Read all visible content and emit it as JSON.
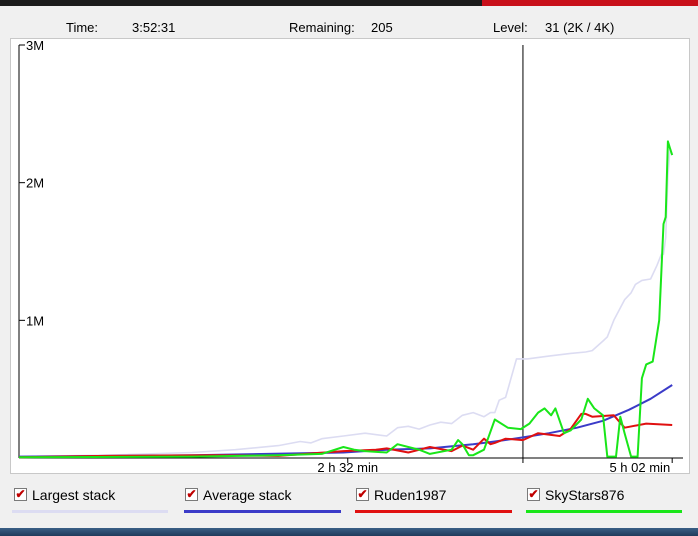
{
  "status": {
    "time_label": "Time:",
    "time_value": "3:52:31",
    "remaining_label": "Remaining:",
    "remaining_value": "205",
    "level_label": "Level:",
    "level_value": "31 (2K / 4K)"
  },
  "legend": [
    {
      "label": "Largest stack",
      "color": "#dcdcf2",
      "checked": true
    },
    {
      "label": "Average stack",
      "color": "#3b3bc8",
      "checked": true
    },
    {
      "label": "Ruden1987",
      "color": "#e01010",
      "checked": true
    },
    {
      "label": "SkyStars876",
      "color": "#19e619",
      "checked": true
    }
  ],
  "chart_data": {
    "type": "line",
    "title": "",
    "xlabel": "",
    "ylabel": "",
    "x_unit": "minutes",
    "xlim": [
      0,
      307
    ],
    "ylim": [
      0,
      3000000
    ],
    "y_ticks": [
      {
        "value": 1000000,
        "label": "1M"
      },
      {
        "value": 2000000,
        "label": "2M"
      },
      {
        "value": 3000000,
        "label": "3M"
      }
    ],
    "x_ticks": [
      {
        "value": 152,
        "label": "2 h 32 min"
      },
      {
        "value": 302,
        "label": "5 h 02 min"
      }
    ],
    "vertical_marker_x": 233,
    "grid": false,
    "series": [
      {
        "name": "Largest stack",
        "color": "#dcdcf2",
        "x": [
          0,
          40,
          80,
          100,
          120,
          130,
          135,
          140,
          150,
          160,
          170,
          175,
          180,
          185,
          190,
          195,
          200,
          205,
          210,
          215,
          218,
          220,
          222,
          225,
          230,
          235,
          245,
          255,
          262,
          265,
          270,
          272,
          275,
          280,
          283,
          285,
          288,
          292,
          295,
          297,
          298,
          299,
          300,
          301,
          302
        ],
        "y": [
          10000,
          20000,
          40000,
          60000,
          90000,
          120000,
          110000,
          140000,
          160000,
          180000,
          160000,
          220000,
          230000,
          210000,
          240000,
          260000,
          250000,
          310000,
          330000,
          300000,
          330000,
          330000,
          420000,
          440000,
          720000,
          720000,
          740000,
          760000,
          770000,
          780000,
          850000,
          880000,
          1000000,
          1150000,
          1200000,
          1260000,
          1290000,
          1300000,
          1400000,
          1480000,
          1480000,
          1600000,
          2050000,
          2250000,
          2200000
        ]
      },
      {
        "name": "Average stack",
        "color": "#3b3bc8",
        "x": [
          0,
          80,
          150,
          170,
          190,
          210,
          220,
          233,
          245,
          258,
          270,
          282,
          292,
          302
        ],
        "y": [
          10000,
          20000,
          40000,
          60000,
          70000,
          100000,
          120000,
          150000,
          180000,
          220000,
          270000,
          350000,
          430000,
          530000
        ]
      },
      {
        "name": "Ruden1987",
        "color": "#e01010",
        "x": [
          0,
          40,
          90,
          120,
          150,
          165,
          170,
          180,
          190,
          200,
          205,
          210,
          215,
          218,
          220,
          225,
          233,
          240,
          250,
          255,
          260,
          262,
          265,
          275,
          280,
          290,
          302
        ],
        "y": [
          5000,
          15000,
          20000,
          15000,
          50000,
          60000,
          70000,
          40000,
          80000,
          50000,
          90000,
          60000,
          140000,
          100000,
          110000,
          140000,
          130000,
          180000,
          160000,
          210000,
          320000,
          320000,
          300000,
          310000,
          220000,
          250000,
          240000
        ]
      },
      {
        "name": "SkyStars876",
        "color": "#19e619",
        "x": [
          0,
          80,
          120,
          140,
          150,
          155,
          160,
          170,
          175,
          180,
          185,
          190,
          200,
          203,
          205,
          208,
          210,
          215,
          220,
          226,
          232,
          236,
          240,
          243,
          246,
          248,
          252,
          255,
          260,
          263,
          266,
          270,
          272,
          276,
          278,
          280,
          283,
          286,
          288,
          290,
          293,
          296,
          298,
          299,
          300,
          301,
          302
        ],
        "y": [
          5000,
          10000,
          20000,
          30000,
          80000,
          60000,
          50000,
          40000,
          100000,
          80000,
          60000,
          30000,
          60000,
          130000,
          100000,
          20000,
          20000,
          60000,
          280000,
          220000,
          210000,
          250000,
          330000,
          360000,
          310000,
          360000,
          180000,
          200000,
          280000,
          430000,
          360000,
          310000,
          10000,
          10000,
          300000,
          180000,
          10000,
          10000,
          580000,
          680000,
          700000,
          1000000,
          1700000,
          1750000,
          2300000,
          2250000,
          2200000
        ]
      }
    ]
  }
}
